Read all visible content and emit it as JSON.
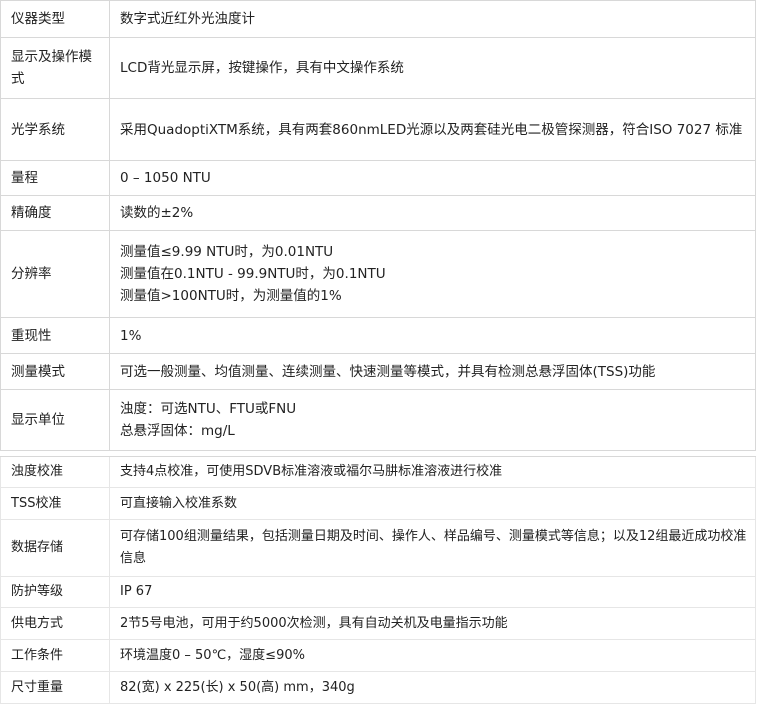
{
  "specs_a": [
    {
      "label": "仪器类型",
      "value": [
        "数字式近红外光浊度计"
      ]
    },
    {
      "label": "显示及操作模式",
      "value": [
        "LCD背光显示屏，按键操作，具有中文操作系统"
      ]
    },
    {
      "label": "光学系统",
      "value": [
        "采用QuadoptiXTM系统，具有两套860nmLED光源以及两套硅光电二极管探测器，符合ISO 7027 标准"
      ]
    },
    {
      "label": "量程",
      "value": [
        "0 – 1050 NTU"
      ]
    },
    {
      "label": "精确度",
      "value": [
        "读数的±2%"
      ]
    },
    {
      "label": "分辨率",
      "value": [
        "测量值≤9.99 NTU时，为0.01NTU",
        "测量值在0.1NTU - 99.9NTU时，为0.1NTU",
        "测量值>100NTU时，为测量值的1%"
      ]
    },
    {
      "label": "重现性",
      "value": [
        "1%"
      ]
    },
    {
      "label": "测量模式",
      "value": [
        "可选一般测量、均值测量、连续测量、快速测量等模式，并具有检测总悬浮固体(TSS)功能"
      ]
    },
    {
      "label": "显示单位",
      "value": [
        "浊度：可选NTU、FTU或FNU",
        "总悬浮固体：mg/L"
      ]
    }
  ],
  "specs_b": [
    {
      "label": "浊度校准",
      "value": [
        "支持4点校准，可使用SDVB标准溶液或福尔马肼标准溶液进行校准"
      ]
    },
    {
      "label": "TSS校准",
      "value": [
        "可直接输入校准系数"
      ]
    },
    {
      "label": "数据存储",
      "value": [
        "可存储100组测量结果，包括测量日期及时间、操作人、样品编号、测量模式等信息；以及12组最近成功校准信息"
      ]
    },
    {
      "label": "防护等级",
      "value": [
        "IP 67"
      ]
    },
    {
      "label": "供电方式",
      "value": [
        "2节5号电池，可用于约5000次检测，具有自动关机及电量指示功能"
      ]
    },
    {
      "label": "工作条件",
      "value": [
        "环境温度0 – 50℃，湿度≤90%"
      ]
    },
    {
      "label": "尺寸重量",
      "value": [
        "82(宽) x 225(长) x 50(高) mm，340g"
      ]
    }
  ]
}
